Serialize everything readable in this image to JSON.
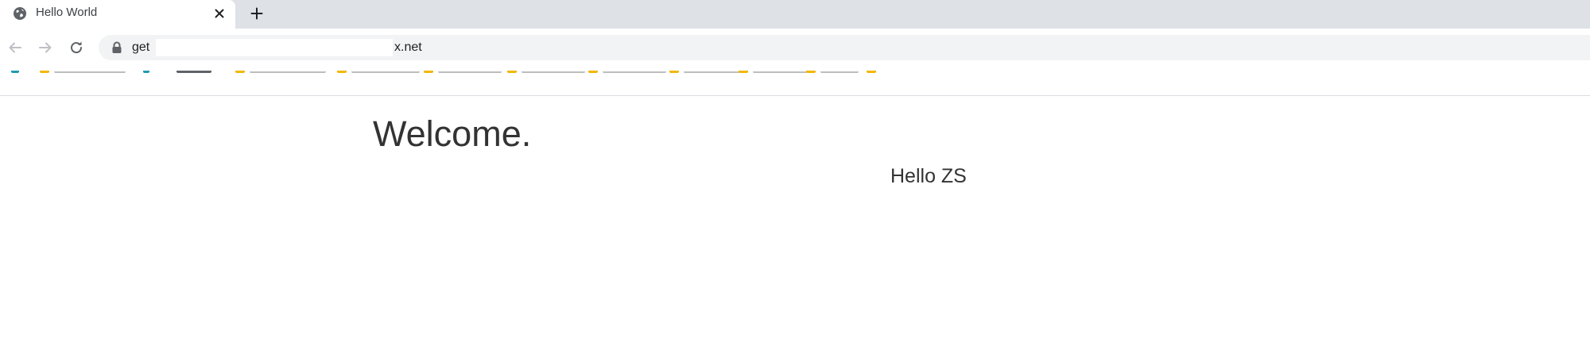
{
  "browser": {
    "tab": {
      "title": "Hello World",
      "favicon": "globe-icon",
      "close_icon": "close-icon"
    },
    "new_tab_icon": "plus-icon",
    "toolbar": {
      "back_icon": "back-arrow-icon",
      "forward_icon": "forward-arrow-icon",
      "reload_icon": "reload-icon"
    },
    "omnibox": {
      "lock_icon": "lock-icon",
      "url_prefix": "get",
      "url_suffix": "x.net"
    }
  },
  "page": {
    "heading": "Welcome.",
    "greeting": "Hello ZS"
  },
  "colors": {
    "tabstrip_bg": "#dee1e6",
    "omnibox_bg": "#f1f3f4",
    "bookmark_folder": "#f2b705",
    "text": "#333333"
  }
}
